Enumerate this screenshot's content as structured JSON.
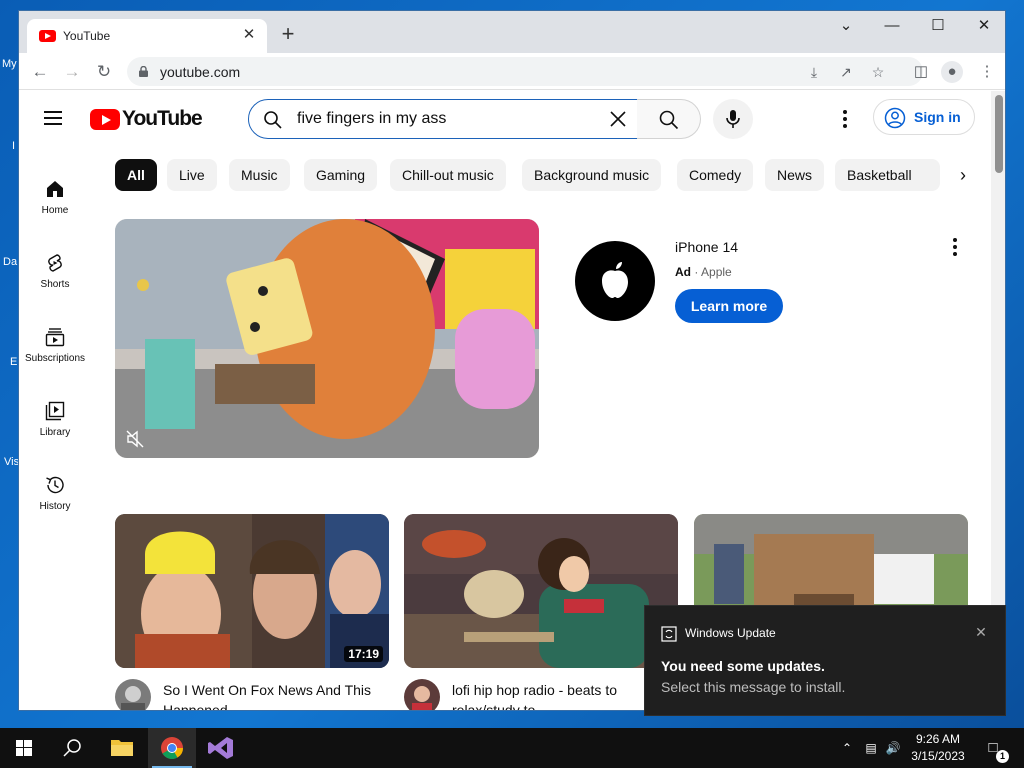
{
  "desktop": {
    "fragments": [
      "My",
      "I",
      "Da",
      "E",
      "Vis"
    ]
  },
  "browser": {
    "tab": {
      "title": "YouTube",
      "close": "✕"
    },
    "new_tab": "+",
    "url": "youtube.com",
    "window_controls": {
      "chevron": "⌄",
      "minimize": "—",
      "maximize": "☐",
      "close": "✕"
    }
  },
  "youtube": {
    "logo_text": "YouTube",
    "search": {
      "value": "five fingers in my ass"
    },
    "signin": "Sign in",
    "sidebar": [
      {
        "label": "Home",
        "icon": "home-icon"
      },
      {
        "label": "Shorts",
        "icon": "shorts-icon"
      },
      {
        "label": "Subscriptions",
        "icon": "subscriptions-icon"
      },
      {
        "label": "Library",
        "icon": "library-icon"
      },
      {
        "label": "History",
        "icon": "history-icon"
      }
    ],
    "chips": [
      "All",
      "Live",
      "Music",
      "Gaming",
      "Chill-out music",
      "Background music",
      "Comedy",
      "News",
      "Basketball"
    ],
    "ad": {
      "title": "iPhone 14",
      "badge": "Ad",
      "advertiser": "Apple",
      "cta": "Learn more"
    },
    "videos": [
      {
        "title": "So I Went On Fox News And This Happened",
        "duration": "17:19"
      },
      {
        "title": "lofi hip hop radio - beats to relax/study to",
        "duration": ""
      },
      {
        "title": "",
        "duration": ""
      }
    ]
  },
  "notification": {
    "app": "Windows Update",
    "title": "You need some updates.",
    "body": "Select this message to install.",
    "close": "✕"
  },
  "taskbar": {
    "time": "9:26 AM",
    "date": "3/15/2023",
    "notification_count": "1"
  },
  "colors": {
    "youtube_red": "#ff0000",
    "link_blue": "#065fd4",
    "desktop_blue": "#0b5fa8"
  }
}
